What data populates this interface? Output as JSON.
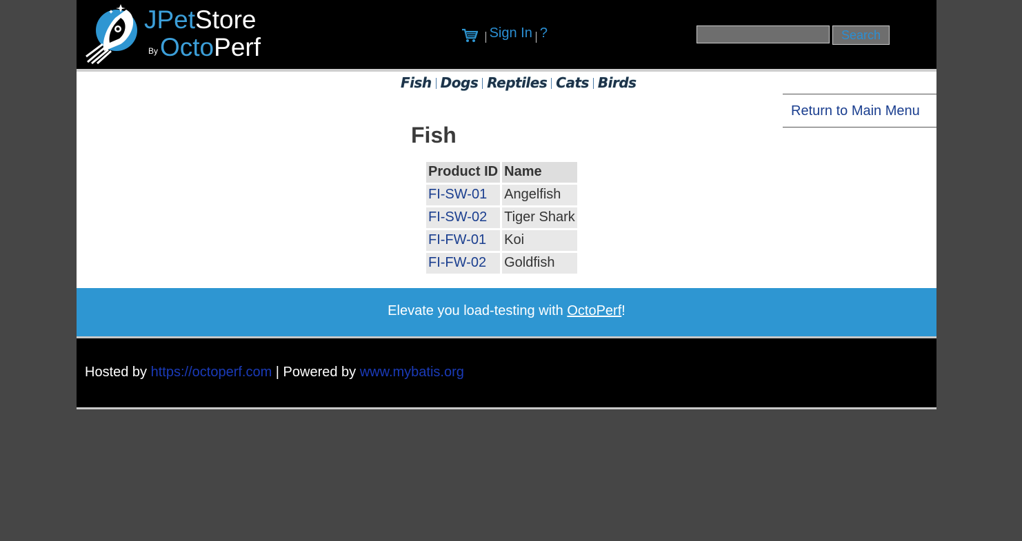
{
  "header": {
    "logo": {
      "jpet": "JPet",
      "store": "Store",
      "by": "By",
      "octo": "Octo",
      "perf": "Perf"
    },
    "menu": {
      "cart_icon": "shopping-cart-icon",
      "sign_in": "Sign In",
      "help": "?"
    },
    "search": {
      "value": "",
      "button_label": "Search"
    }
  },
  "quicklinks": [
    "Fish",
    "Dogs",
    "Reptiles",
    "Cats",
    "Birds"
  ],
  "back_link": "Return to Main Menu",
  "catalog": {
    "title": "Fish",
    "columns": [
      "Product ID",
      "Name"
    ],
    "rows": [
      {
        "id": "FI-SW-01",
        "name": "Angelfish"
      },
      {
        "id": "FI-SW-02",
        "name": "Tiger Shark"
      },
      {
        "id": "FI-FW-01",
        "name": "Koi"
      },
      {
        "id": "FI-FW-02",
        "name": "Goldfish"
      }
    ]
  },
  "banner": {
    "prefix": "Elevate you load-testing with ",
    "link": "OctoPerf",
    "suffix": "!"
  },
  "footer": {
    "hosted_prefix": "Hosted by ",
    "hosted_link": "https://octoperf.com",
    "powered_prefix": " | Powered by ",
    "powered_link": "www.mybatis.org"
  },
  "colors": {
    "accent": "#2e96d2",
    "link": "#1a3e8f",
    "background": "#464646"
  }
}
